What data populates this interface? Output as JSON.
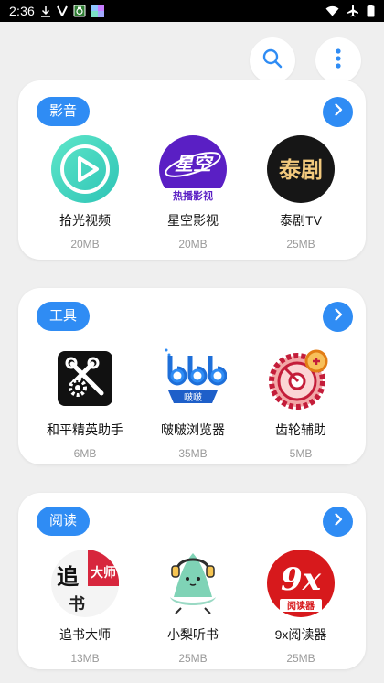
{
  "status_bar": {
    "time": "2:36",
    "left_icons": [
      "download-icon",
      "v-app-icon",
      "photo-app-icon",
      "colorful-app-icon"
    ],
    "right_icons": [
      "wifi-icon",
      "airplane-mode-icon",
      "battery-icon"
    ]
  },
  "topbar": {
    "icons": [
      "search-icon",
      "more-vertical-icon"
    ]
  },
  "accent_color": "#2f8cf4",
  "sections": [
    {
      "title": "影音",
      "apps": [
        {
          "name": "拾光视频",
          "size": "20MB",
          "icon": "play-circle-icon"
        },
        {
          "name": "星空影视",
          "size": "20MB",
          "icon": "xingkong-logo-icon",
          "icon_text": "星空",
          "icon_subtext": "热播影视"
        },
        {
          "name": "泰剧TV",
          "size": "25MB",
          "icon": "taiju-logo-icon",
          "icon_text": "泰剧"
        }
      ]
    },
    {
      "title": "工具",
      "apps": [
        {
          "name": "和平精英助手",
          "size": "6MB",
          "icon": "wrench-gear-icon"
        },
        {
          "name": "啵啵浏览器",
          "size": "35MB",
          "icon": "bobo-browser-icon",
          "icon_text": "啵啵"
        },
        {
          "name": "齿轮辅助",
          "size": "5MB",
          "icon": "gear-record-icon"
        }
      ]
    },
    {
      "title": "阅读",
      "apps": [
        {
          "name": "追书大师",
          "size": "13MB",
          "icon": "zhuishu-logo-icon",
          "icon_text": "追",
          "icon_text_2": "大师",
          "icon_text_3": "书"
        },
        {
          "name": "小梨听书",
          "size": "25MB",
          "icon": "pear-headphones-icon"
        },
        {
          "name": "9x阅读器",
          "size": "25MB",
          "icon": "9x-logo-icon",
          "icon_text": "9x",
          "icon_subtext": "阅读器"
        }
      ]
    }
  ]
}
